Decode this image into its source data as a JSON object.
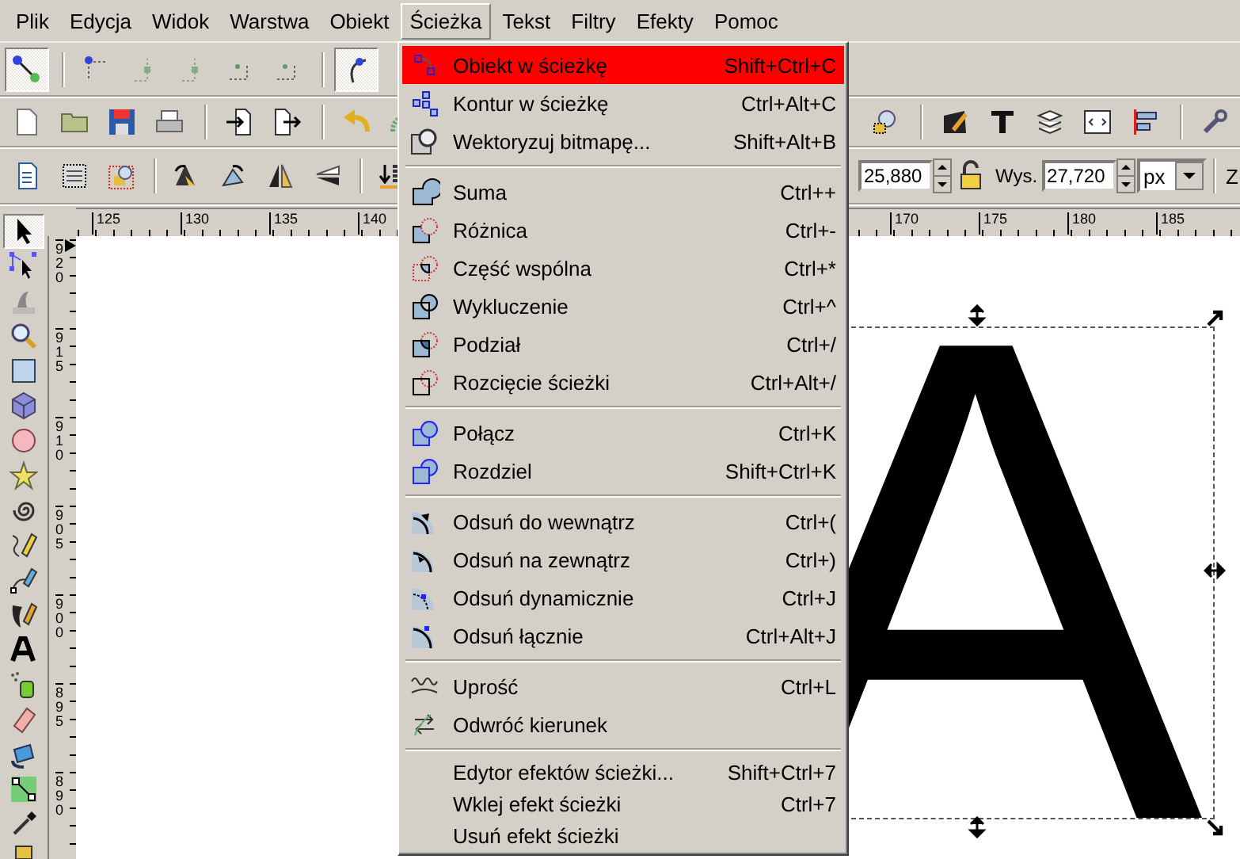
{
  "menubar": [
    {
      "label": "Plik",
      "selected": false
    },
    {
      "label": "Edycja",
      "selected": false
    },
    {
      "label": "Widok",
      "selected": false
    },
    {
      "label": "Warstwa",
      "selected": false
    },
    {
      "label": "Obiekt",
      "selected": false
    },
    {
      "label": "Ścieżka",
      "selected": true
    },
    {
      "label": "Tekst",
      "selected": false
    },
    {
      "label": "Filtry",
      "selected": false
    },
    {
      "label": "Efekty",
      "selected": false
    },
    {
      "label": "Pomoc",
      "selected": false
    }
  ],
  "node_toolbar": {
    "buttons": [
      {
        "pressed": true
      },
      {
        "pressed": false
      },
      {
        "pressed": false
      },
      {
        "pressed": false
      },
      {
        "pressed": false
      },
      {
        "pressed": false
      },
      {
        "pressed": true
      }
    ]
  },
  "select_toolbar": {
    "x_value": "25,880",
    "height_label": "Wys.",
    "height_value": "27,720",
    "unit": "px",
    "cut_label": "Z"
  },
  "rulers": {
    "horizontal": [
      "125",
      "130",
      "135",
      "140",
      "170",
      "175",
      "180",
      "185"
    ],
    "vertical": [
      "920",
      "915",
      "910",
      "905",
      "900",
      "895",
      "890"
    ]
  },
  "toolbox": {
    "tools": [
      {
        "selected": true
      },
      {
        "selected": false
      },
      {
        "selected": false
      },
      {
        "selected": false
      },
      {
        "selected": false
      },
      {
        "selected": false
      },
      {
        "selected": false
      },
      {
        "selected": false
      },
      {
        "selected": false
      },
      {
        "selected": false
      },
      {
        "selected": false
      },
      {
        "selected": false
      },
      {
        "selected": false
      },
      {
        "selected": false
      },
      {
        "selected": false
      },
      {
        "selected": false
      },
      {
        "selected": false
      },
      {
        "selected": false
      },
      {
        "selected": false
      }
    ]
  },
  "canvas": {
    "text": "A",
    "selected": true
  },
  "path_menu": {
    "groups": [
      [
        {
          "label": "Obiekt w ścieżkę",
          "shortcut": "Shift+Ctrl+C",
          "selected": true
        },
        {
          "label": "Kontur w ścieżkę",
          "shortcut": "Ctrl+Alt+C",
          "selected": false
        },
        {
          "label": "Wektoryzuj bitmapę...",
          "shortcut": "Shift+Alt+B",
          "selected": false
        }
      ],
      [
        {
          "label": "Suma",
          "shortcut": "Ctrl++",
          "selected": false
        },
        {
          "label": "Różnica",
          "shortcut": "Ctrl+-",
          "selected": false
        },
        {
          "label": "Część wspólna",
          "shortcut": "Ctrl+*",
          "selected": false
        },
        {
          "label": "Wykluczenie",
          "shortcut": "Ctrl+^",
          "selected": false
        },
        {
          "label": "Podział",
          "shortcut": "Ctrl+/",
          "selected": false
        },
        {
          "label": "Rozcięcie ścieżki",
          "shortcut": "Ctrl+Alt+/",
          "selected": false
        }
      ],
      [
        {
          "label": "Połącz",
          "shortcut": "Ctrl+K",
          "selected": false
        },
        {
          "label": "Rozdziel",
          "shortcut": "Shift+Ctrl+K",
          "selected": false
        }
      ],
      [
        {
          "label": "Odsuń do wewnątrz",
          "shortcut": "Ctrl+(",
          "selected": false
        },
        {
          "label": "Odsuń na zewnątrz",
          "shortcut": "Ctrl+)",
          "selected": false
        },
        {
          "label": "Odsuń dynamicznie",
          "shortcut": "Ctrl+J",
          "selected": false
        },
        {
          "label": "Odsuń łącznie",
          "shortcut": "Ctrl+Alt+J",
          "selected": false
        }
      ],
      [
        {
          "label": "Uprość",
          "shortcut": "Ctrl+L",
          "selected": false
        },
        {
          "label": "Odwróć kierunek",
          "selected": false
        }
      ],
      [
        {
          "label": "Edytor efektów ścieżki...",
          "shortcut": "Shift+Ctrl+7",
          "selected": false
        },
        {
          "label": "Wklej efekt ścieżki",
          "shortcut": "Ctrl+7",
          "selected": false
        },
        {
          "label": "Usuń efekt ścieżki",
          "selected": false
        }
      ]
    ]
  }
}
